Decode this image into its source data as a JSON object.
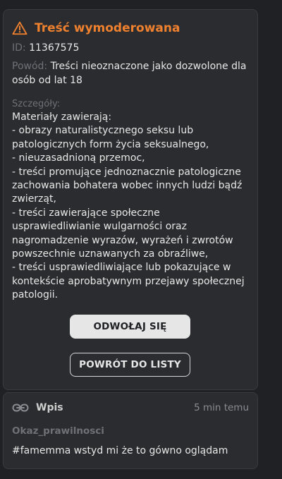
{
  "moderation": {
    "title": "Treść wymoderowana",
    "id_label": "ID:",
    "id_value": "11367575",
    "reason_label": "Powód:",
    "reason_value": "Treści nieoznaczone jako dozwolone dla osób od lat 18",
    "details_label": "Szczegóły:",
    "details_text": "Materiały zawierają:\n- obrazy naturalistycznego seksu lub patologicznych form życia seksualnego,\n- nieuzasadnioną przemoc,\n- treści promujące jednoznacznie patologiczne zachowania bohatera wobec innych ludzi bądź zwierząt,\n- treści zawierające społeczne usprawiedliwianie wulgarności oraz nagromadzenie wyrazów, wyrażeń i zwrotów powszechnie uznawanych za obraźliwe,\n- treści usprawiedliwiające lub pokazujące w kontekście aprobatywnym przejawy społecznej patologii.",
    "appeal_button": "ODWOŁAJ SIĘ",
    "back_button": "POWRÓT DO LISTY"
  },
  "post": {
    "type_label": "Wpis",
    "time": "5 min temu",
    "author": "Okaz_prawilnosci",
    "text": "#famemma wstyd mi że to gówno oglądam"
  },
  "colors": {
    "accent": "#f0812f",
    "background": "#202124",
    "card": "#2b2c2f"
  },
  "icons": {
    "warning": "warning-triangle-icon",
    "link": "link-icon"
  }
}
